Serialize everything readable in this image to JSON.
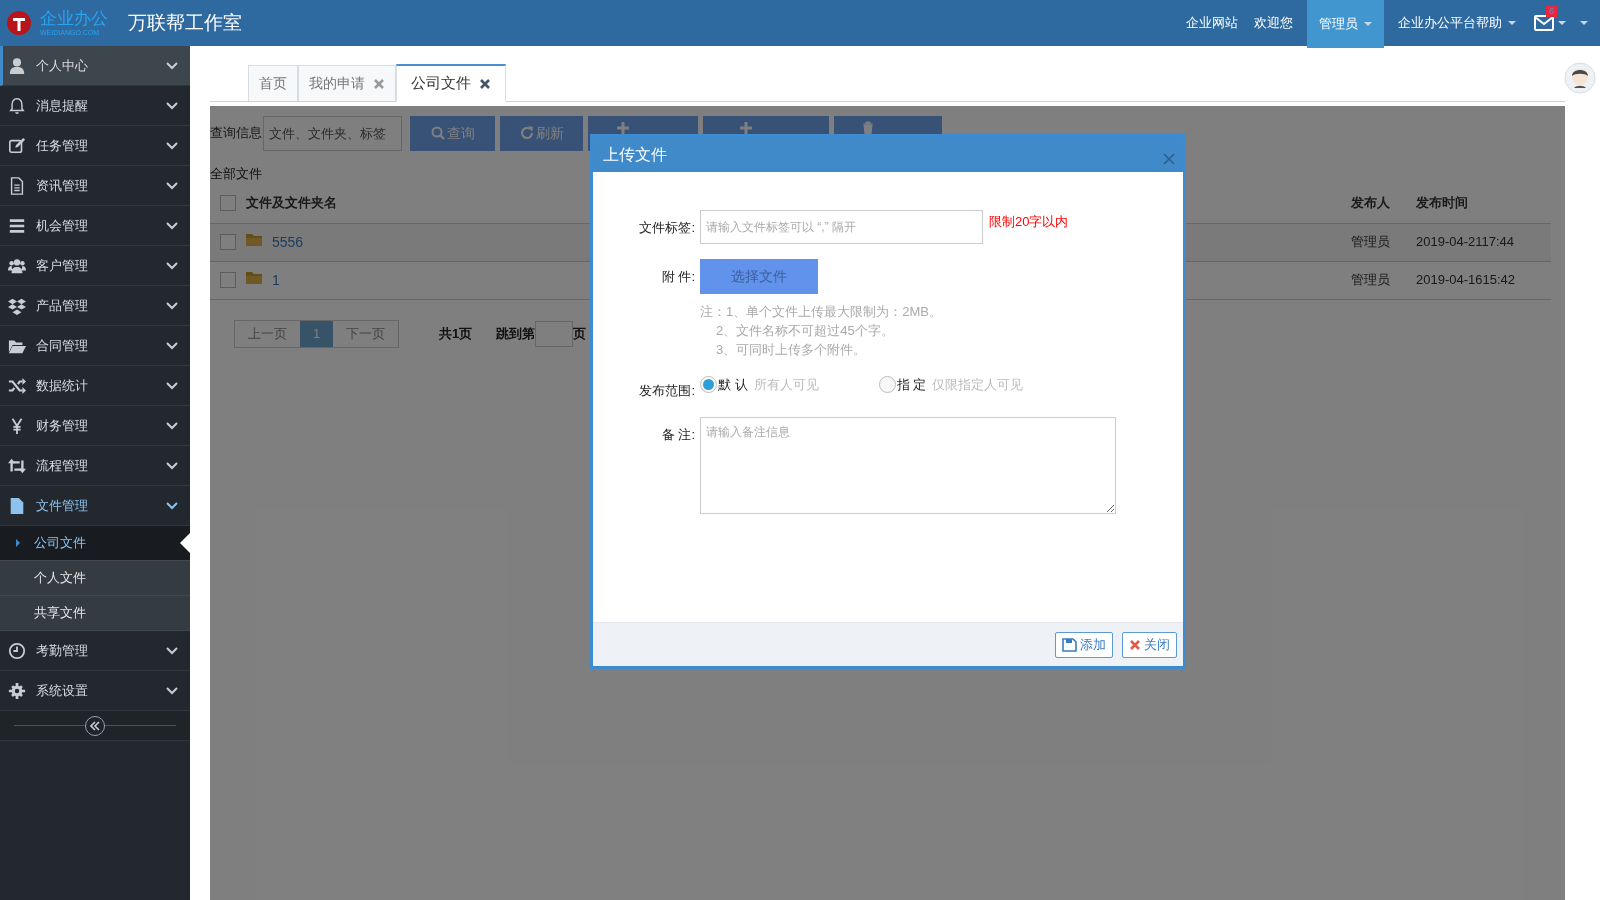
{
  "header": {
    "logo": {
      "name": "企业办公",
      "sub": "WEIDIANGO.COM"
    },
    "title": "万联帮工作室",
    "nav": [
      {
        "label": "企业网站",
        "selected": false,
        "dropdown": false
      },
      {
        "label": "欢迎您",
        "selected": false,
        "dropdown": false
      },
      {
        "label": "管理员",
        "selected": true,
        "dropdown": true
      },
      {
        "label": "企业办公平台帮助",
        "selected": false,
        "dropdown": true
      }
    ],
    "mail_badge": "6"
  },
  "sidebar": {
    "items": [
      {
        "label": "个人中心",
        "selected": true,
        "expanded": false
      },
      {
        "label": "消息提醒",
        "selected": false,
        "expanded": false
      },
      {
        "label": "任务管理",
        "selected": false,
        "expanded": false
      },
      {
        "label": "资讯管理",
        "selected": false,
        "expanded": false
      },
      {
        "label": "机会管理",
        "selected": false,
        "expanded": false
      },
      {
        "label": "客户管理",
        "selected": false,
        "expanded": false
      },
      {
        "label": "产品管理",
        "selected": false,
        "expanded": false
      },
      {
        "label": "合同管理",
        "selected": false,
        "expanded": false
      },
      {
        "label": "数据统计",
        "selected": false,
        "expanded": false
      },
      {
        "label": "财务管理",
        "selected": false,
        "expanded": false
      },
      {
        "label": "流程管理",
        "selected": false,
        "expanded": false
      },
      {
        "label": "文件管理",
        "selected": false,
        "expanded": true,
        "children": [
          {
            "label": "公司文件",
            "selected": true
          },
          {
            "label": "个人文件",
            "selected": false
          },
          {
            "label": "共享文件",
            "selected": false
          }
        ]
      },
      {
        "label": "考勤管理",
        "selected": false,
        "expanded": false
      },
      {
        "label": "系统设置",
        "selected": false,
        "expanded": false
      }
    ]
  },
  "tabs": [
    {
      "label": "首页",
      "selected": false,
      "closable": false
    },
    {
      "label": "我的申请",
      "selected": false,
      "closable": true
    },
    {
      "label": "公司文件",
      "selected": true,
      "closable": true
    }
  ],
  "toolbar": {
    "query_label": "查询信息",
    "search_placeholder": "文件、文件夹、标签",
    "buttons": [
      {
        "kind": "search",
        "label": "查询"
      },
      {
        "kind": "refresh",
        "label": "刷新"
      },
      {
        "kind": "add"
      },
      {
        "kind": "add"
      },
      {
        "kind": "delete"
      }
    ]
  },
  "breadcrumb": "全部文件",
  "table": {
    "select_all_checked": false,
    "columns": [
      "文件及文件夹名",
      "发布人",
      "发布时间"
    ],
    "rows": [
      {
        "name": "5556",
        "publisher": "管理员",
        "time": "2019-04-2117:44",
        "checked": false
      },
      {
        "name": "1",
        "publisher": "管理员",
        "time": "2019-04-1615:42",
        "checked": false
      }
    ]
  },
  "pagination": {
    "prev": "上一页",
    "pages": [
      {
        "label": "1",
        "selected": true
      }
    ],
    "next": "下一页",
    "total": "共1页",
    "jump_label": "跳到第",
    "jump_suffix": "页"
  },
  "modal": {
    "title": "上传文件",
    "tag_label": "文件标签:",
    "tag_placeholder": "请输入文件标签可以 “,” 隔开",
    "tag_hint": "限制20字以内",
    "attach_label": "附 件:",
    "attach_button": "选择文件",
    "notes": [
      "注：1、单个文件上传最大限制为：2MB。",
      "2、文件名称不可超过45个字。",
      "3、可同时上传多个附件。"
    ],
    "scope_label": "发布范围:",
    "scope_options": [
      {
        "label": "默 认",
        "desc": "所有人可见",
        "selected": true
      },
      {
        "label": "指 定",
        "desc": "仅限指定人可见",
        "selected": false
      }
    ],
    "remark_label": "备 注:",
    "remark_placeholder": "请输入备注信息",
    "buttons": [
      {
        "label": "添加",
        "kind": "save"
      },
      {
        "label": "关闭",
        "kind": "close"
      }
    ]
  }
}
